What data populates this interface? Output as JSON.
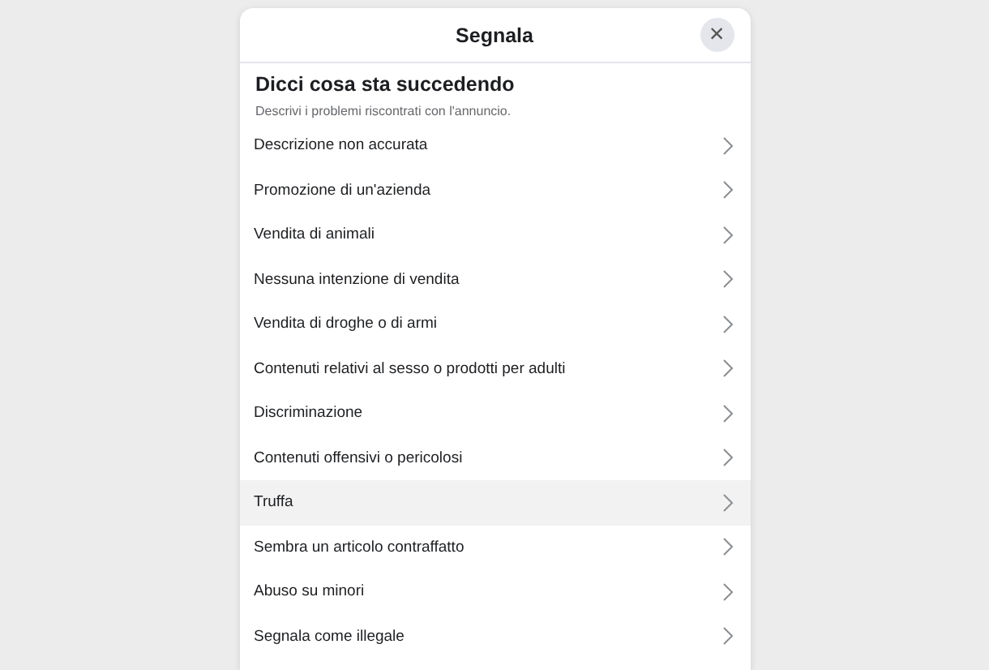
{
  "dialog": {
    "title": "Segnala",
    "close": "×",
    "heading": "Dicci cosa sta succedendo",
    "subtitle": "Descrivi i problemi riscontrati con l'annuncio.",
    "options": [
      {
        "label": "Descrizione non accurata",
        "selected": false
      },
      {
        "label": "Promozione di un'azienda",
        "selected": false
      },
      {
        "label": "Vendita di animali",
        "selected": false
      },
      {
        "label": "Nessuna intenzione di vendita",
        "selected": false
      },
      {
        "label": "Vendita di droghe o di armi",
        "selected": false
      },
      {
        "label": "Contenuti relativi al sesso o prodotti per adulti",
        "selected": false
      },
      {
        "label": "Discriminazione",
        "selected": false
      },
      {
        "label": "Contenuti offensivi o pericolosi",
        "selected": false
      },
      {
        "label": "Truffa",
        "selected": true
      },
      {
        "label": "Sembra un articolo contraffatto",
        "selected": false
      },
      {
        "label": "Abuso su minori",
        "selected": false
      },
      {
        "label": "Segnala come illegale",
        "selected": false
      }
    ]
  }
}
